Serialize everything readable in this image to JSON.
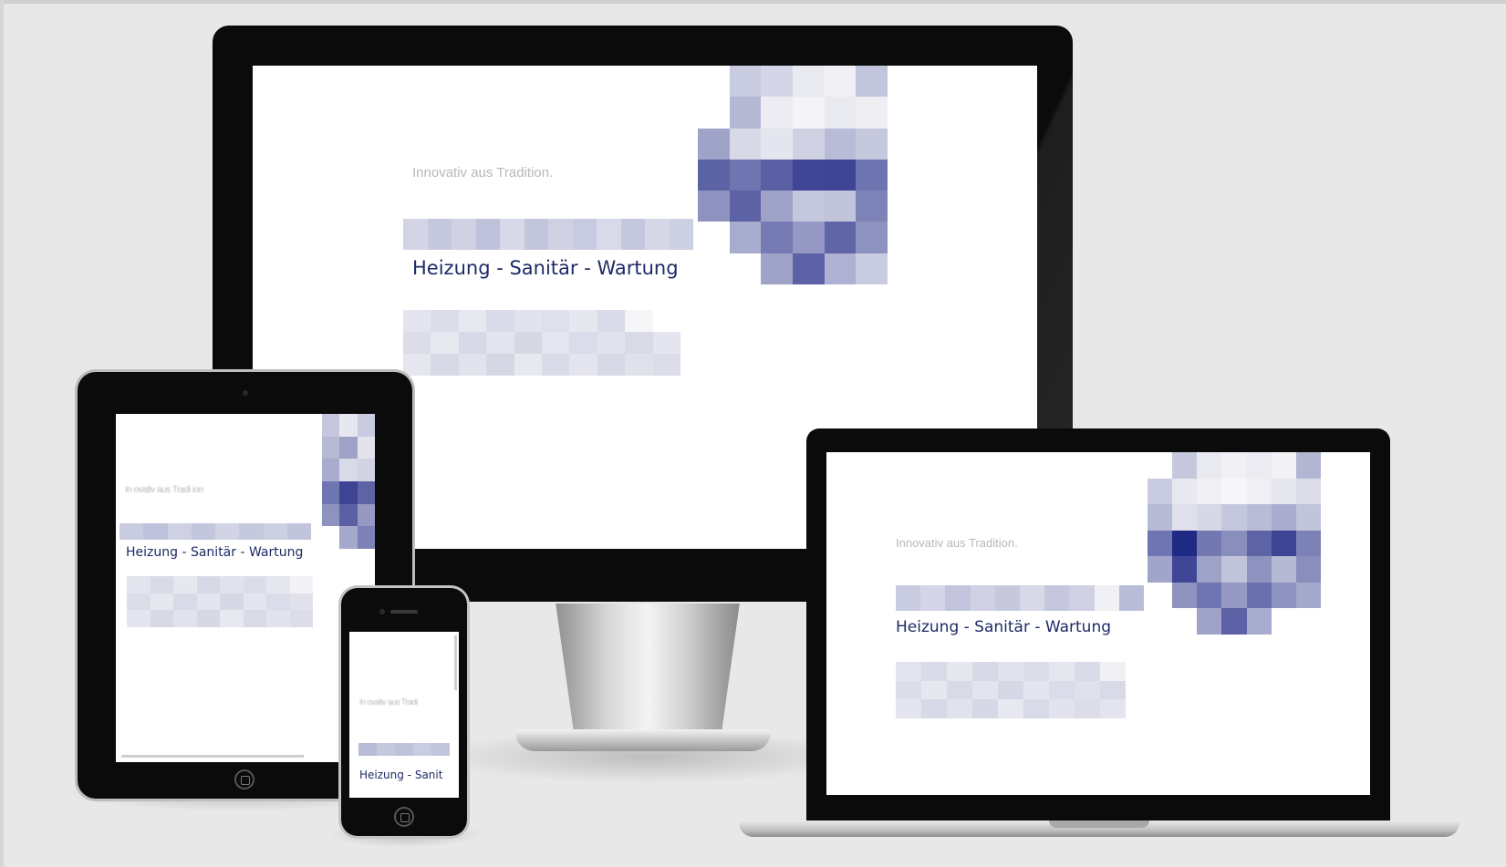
{
  "tagline": "Innovativ aus Tradition.",
  "tagline_small": "In ovativ aus Tradi ion",
  "tagline_phone": "In ovativ aus Tradi",
  "services": "Heizung - Sanitär - Wartung",
  "services_phone": "Heizung - Sanit",
  "colors": {
    "background": "#e8e8e8",
    "bezel": "#0b0b0b",
    "screen": "#ffffff",
    "brand_navy": "#1e2a66",
    "tagline_gray": "#b8b8bd"
  },
  "icons": [
    "home-button-icon",
    "camera-icon",
    "speaker-icon"
  ]
}
